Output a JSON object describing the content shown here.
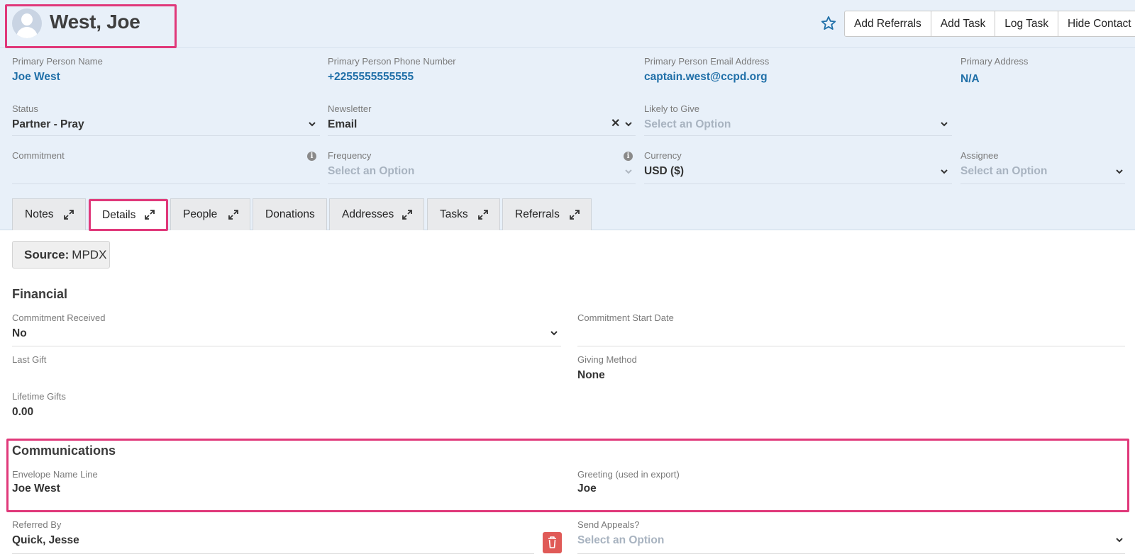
{
  "contact": {
    "name": "West, Joe"
  },
  "actions": {
    "add_referrals": "Add Referrals",
    "add_task": "Add Task",
    "log_task": "Log Task",
    "hide_contact": "Hide Contact"
  },
  "header_fields": {
    "primary_person_name": {
      "label": "Primary Person Name",
      "value": "Joe West"
    },
    "primary_person_phone": {
      "label": "Primary Person Phone Number",
      "value": "+2255555555555"
    },
    "primary_person_email": {
      "label": "Primary Person Email Address",
      "value": "captain.west@ccpd.org"
    },
    "primary_address": {
      "label": "Primary Address",
      "value": "N/A"
    },
    "status": {
      "label": "Status",
      "value": "Partner - Pray"
    },
    "newsletter": {
      "label": "Newsletter",
      "value": "Email"
    },
    "likely_to_give": {
      "label": "Likely to Give",
      "placeholder": "Select an Option"
    },
    "commitment": {
      "label": "Commitment",
      "value": ""
    },
    "frequency": {
      "label": "Frequency",
      "placeholder": "Select an Option"
    },
    "currency": {
      "label": "Currency",
      "value": "USD ($)"
    },
    "assignee": {
      "label": "Assignee",
      "placeholder": "Select an Option"
    }
  },
  "tabs": [
    {
      "label": "Notes"
    },
    {
      "label": "Details"
    },
    {
      "label": "People"
    },
    {
      "label": "Donations"
    },
    {
      "label": "Addresses"
    },
    {
      "label": "Tasks"
    },
    {
      "label": "Referrals"
    }
  ],
  "source": {
    "label": "Source:",
    "value": "MPDX"
  },
  "financial": {
    "title": "Financial",
    "commitment_received": {
      "label": "Commitment Received",
      "value": "No"
    },
    "commitment_start_date": {
      "label": "Commitment Start Date",
      "value": ""
    },
    "last_gift": {
      "label": "Last Gift",
      "value": ""
    },
    "giving_method": {
      "label": "Giving Method",
      "value": "None"
    },
    "lifetime_gifts": {
      "label": "Lifetime Gifts",
      "value": "0.00"
    }
  },
  "communications": {
    "title": "Communications",
    "envelope_name_line": {
      "label": "Envelope Name Line",
      "value": "Joe West"
    },
    "greeting": {
      "label": "Greeting (used in export)",
      "value": "Joe"
    }
  },
  "referred_by": {
    "label": "Referred By",
    "value": "Quick, Jesse"
  },
  "send_appeals": {
    "label": "Send Appeals?",
    "placeholder": "Select an Option"
  },
  "icons": {
    "avatar": "user-avatar-icon",
    "star": "star-outline-icon",
    "chevron": "chevron-down-icon",
    "info": "info-icon",
    "clear": "clear-x-icon",
    "expand": "expand-arrows-icon",
    "trash": "trash-icon"
  },
  "colors": {
    "link": "#1f6fa8",
    "highlight": "#e0387a",
    "danger": "#e05a57",
    "header_bg": "#e8f0f9"
  }
}
